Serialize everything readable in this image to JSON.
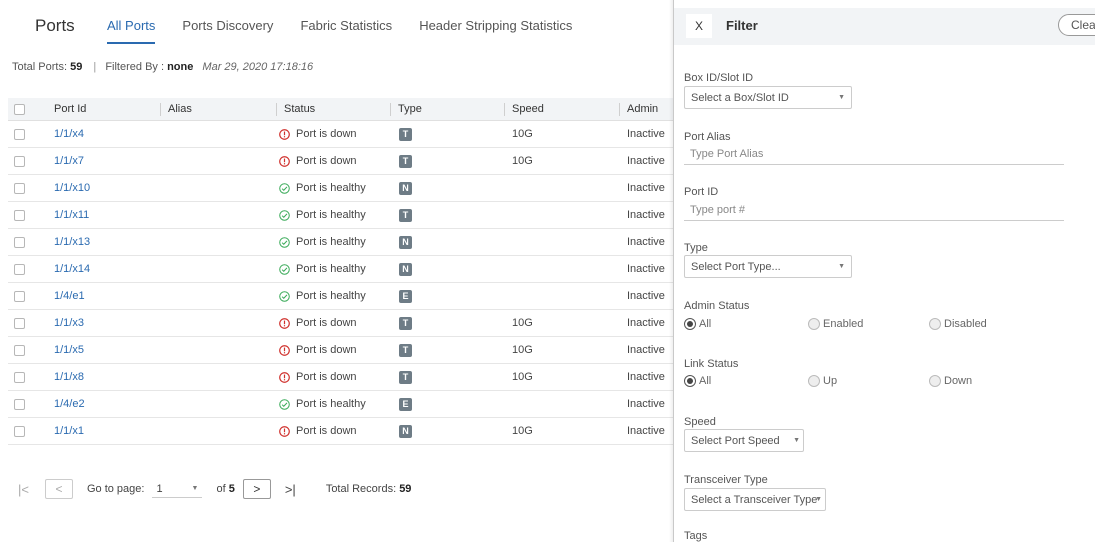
{
  "header": {
    "title": "Ports",
    "tabs": [
      {
        "label": "All Ports",
        "active": true
      },
      {
        "label": "Ports Discovery",
        "active": false
      },
      {
        "label": "Fabric Statistics",
        "active": false
      },
      {
        "label": "Header Stripping Statistics",
        "active": false
      }
    ]
  },
  "summary": {
    "total_label": "Total Ports:",
    "total_value": "59",
    "filtered_label": "Filtered By :",
    "filtered_value": "none",
    "timestamp": "Mar 29, 2020 17:18:16"
  },
  "table": {
    "columns": [
      "Port Id",
      "Alias",
      "Status",
      "Type",
      "Speed",
      "Admin"
    ],
    "rows": [
      {
        "port": "1/1/x4",
        "alias": "",
        "status": "Port is down",
        "state": "down",
        "type": "T",
        "speed": "10G",
        "admin": "Inactive"
      },
      {
        "port": "1/1/x7",
        "alias": "",
        "status": "Port is down",
        "state": "down",
        "type": "T",
        "speed": "10G",
        "admin": "Inactive"
      },
      {
        "port": "1/1/x10",
        "alias": "",
        "status": "Port is healthy",
        "state": "healthy",
        "type": "N",
        "speed": "",
        "admin": "Inactive"
      },
      {
        "port": "1/1/x11",
        "alias": "",
        "status": "Port is healthy",
        "state": "healthy",
        "type": "T",
        "speed": "",
        "admin": "Inactive"
      },
      {
        "port": "1/1/x13",
        "alias": "",
        "status": "Port is healthy",
        "state": "healthy",
        "type": "N",
        "speed": "",
        "admin": "Inactive"
      },
      {
        "port": "1/1/x14",
        "alias": "",
        "status": "Port is healthy",
        "state": "healthy",
        "type": "N",
        "speed": "",
        "admin": "Inactive"
      },
      {
        "port": "1/4/e1",
        "alias": "",
        "status": "Port is healthy",
        "state": "healthy",
        "type": "E",
        "speed": "",
        "admin": "Inactive"
      },
      {
        "port": "1/1/x3",
        "alias": "",
        "status": "Port is down",
        "state": "down",
        "type": "T",
        "speed": "10G",
        "admin": "Inactive"
      },
      {
        "port": "1/1/x5",
        "alias": "",
        "status": "Port is down",
        "state": "down",
        "type": "T",
        "speed": "10G",
        "admin": "Inactive"
      },
      {
        "port": "1/1/x8",
        "alias": "",
        "status": "Port is down",
        "state": "down",
        "type": "T",
        "speed": "10G",
        "admin": "Inactive"
      },
      {
        "port": "1/4/e2",
        "alias": "",
        "status": "Port is healthy",
        "state": "healthy",
        "type": "E",
        "speed": "",
        "admin": "Inactive"
      },
      {
        "port": "1/1/x1",
        "alias": "",
        "status": "Port is down",
        "state": "down",
        "type": "N",
        "speed": "10G",
        "admin": "Inactive"
      }
    ]
  },
  "pagination": {
    "goto_label": "Go to page:",
    "current_page": "1",
    "of_label": "of",
    "total_pages": "5",
    "total_records_label": "Total Records:",
    "total_records": "59"
  },
  "filter": {
    "close_label": "X",
    "title": "Filter",
    "clear_label": "Clear",
    "box_slot": {
      "label": "Box ID/Slot ID",
      "placeholder": "Select a Box/Slot ID"
    },
    "port_alias": {
      "label": "Port Alias",
      "placeholder": "Type Port Alias"
    },
    "port_id": {
      "label": "Port ID",
      "placeholder": "Type port #"
    },
    "type": {
      "label": "Type",
      "placeholder": "Select Port Type..."
    },
    "admin_status": {
      "label": "Admin Status",
      "options": [
        "All",
        "Enabled",
        "Disabled"
      ],
      "selected": "All"
    },
    "link_status": {
      "label": "Link Status",
      "options": [
        "All",
        "Up",
        "Down"
      ],
      "selected": "All"
    },
    "speed": {
      "label": "Speed",
      "placeholder": "Select Port Speed"
    },
    "transceiver": {
      "label": "Transceiver Type",
      "placeholder": "Select a Transceiver Type"
    },
    "tags": {
      "label": "Tags"
    }
  },
  "colors": {
    "accent": "#2a6ab0",
    "down": "#d0312d",
    "healthy": "#3bab5a",
    "badge": "#6e7c86"
  },
  "icons": {
    "down": "exclamation-circle-icon",
    "healthy": "check-circle-icon"
  }
}
